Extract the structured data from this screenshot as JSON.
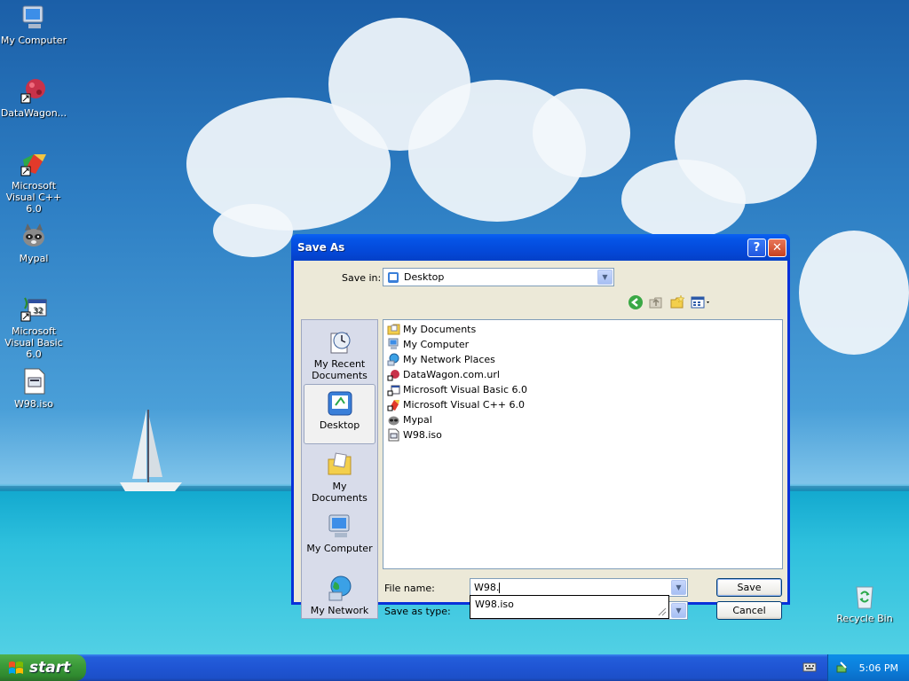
{
  "desktop": {
    "icons": [
      {
        "label": "My Computer"
      },
      {
        "label": "DataWagon..."
      },
      {
        "label": "Microsoft Visual C++ 6.0"
      },
      {
        "label": "Mypal"
      },
      {
        "label": "Microsoft Visual Basic 6.0"
      },
      {
        "label": "W98.iso"
      },
      {
        "label": "Recycle Bin"
      }
    ]
  },
  "taskbar": {
    "start_label": "start",
    "clock": "5:06 PM"
  },
  "dialog": {
    "title": "Save As",
    "help_label": "?",
    "close_label": "✕",
    "save_in_label": "Save in:",
    "save_in_value": "Desktop",
    "places": [
      {
        "label": "My Recent Documents"
      },
      {
        "label": "Desktop"
      },
      {
        "label": "My Documents"
      },
      {
        "label": "My Computer"
      },
      {
        "label": "My Network"
      }
    ],
    "files": [
      {
        "name": "My Documents"
      },
      {
        "name": "My Computer"
      },
      {
        "name": "My Network Places"
      },
      {
        "name": "DataWagon.com.url"
      },
      {
        "name": "Microsoft Visual Basic 6.0"
      },
      {
        "name": "Microsoft Visual C++ 6.0"
      },
      {
        "name": "Mypal"
      },
      {
        "name": "W98.iso"
      }
    ],
    "file_name_label": "File name:",
    "file_name_value": "W98.",
    "save_as_type_label": "Save as type:",
    "autocomplete_suggestion": "W98.iso",
    "save_button": "Save",
    "cancel_button": "Cancel"
  }
}
